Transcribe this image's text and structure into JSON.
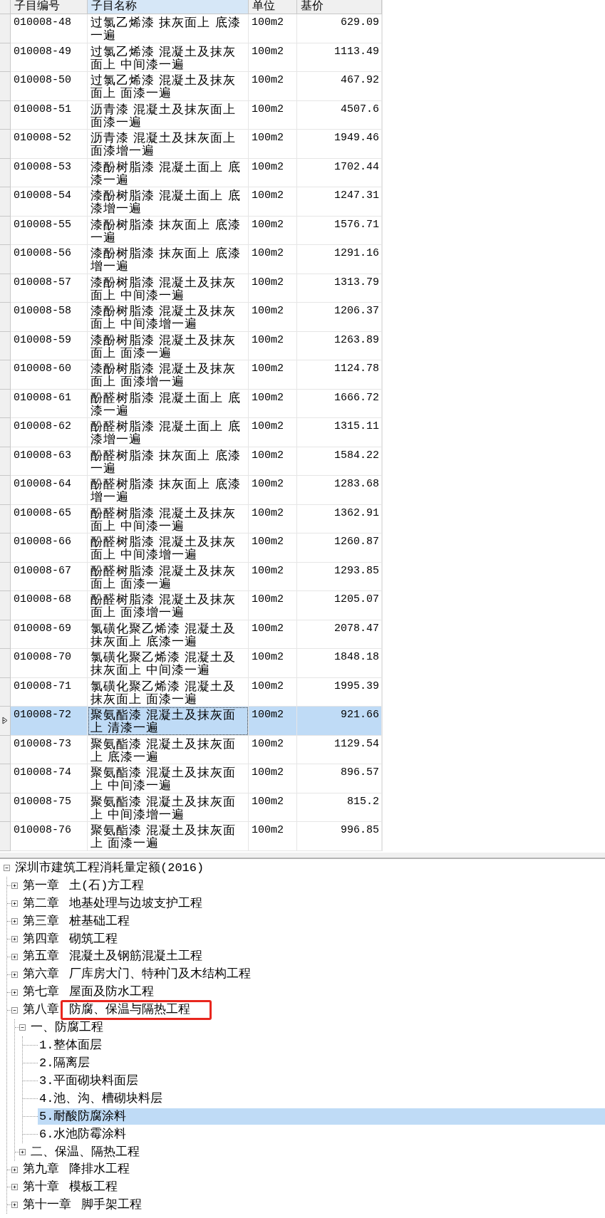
{
  "table": {
    "columns": [
      {
        "label": "子目编号",
        "selected": false
      },
      {
        "label": "子目名称",
        "selected": true
      },
      {
        "label": "单位",
        "selected": false
      },
      {
        "label": "基价",
        "selected": false
      }
    ],
    "rows": [
      {
        "code": "010008-48",
        "name": "过氯乙烯漆 抹灰面上 底漆一遍",
        "unit": "100m2",
        "price": "629.09",
        "selected": false
      },
      {
        "code": "010008-49",
        "name": "过氯乙烯漆 混凝土及抹灰面上 中间漆一遍",
        "unit": "100m2",
        "price": "1113.49",
        "selected": false
      },
      {
        "code": "010008-50",
        "name": "过氯乙烯漆 混凝土及抹灰面上 面漆一遍",
        "unit": "100m2",
        "price": "467.92",
        "selected": false
      },
      {
        "code": "010008-51",
        "name": "沥青漆 混凝土及抹灰面上面漆一遍",
        "unit": "100m2",
        "price": "4507.6",
        "selected": false
      },
      {
        "code": "010008-52",
        "name": "沥青漆 混凝土及抹灰面上面漆增一遍",
        "unit": "100m2",
        "price": "1949.46",
        "selected": false
      },
      {
        "code": "010008-53",
        "name": "漆酚树脂漆 混凝土面上 底漆一遍",
        "unit": "100m2",
        "price": "1702.44",
        "selected": false
      },
      {
        "code": "010008-54",
        "name": "漆酚树脂漆 混凝土面上 底漆增一遍",
        "unit": "100m2",
        "price": "1247.31",
        "selected": false
      },
      {
        "code": "010008-55",
        "name": "漆酚树脂漆 抹灰面上 底漆一遍",
        "unit": "100m2",
        "price": "1576.71",
        "selected": false
      },
      {
        "code": "010008-56",
        "name": "漆酚树脂漆 抹灰面上 底漆增一遍",
        "unit": "100m2",
        "price": "1291.16",
        "selected": false
      },
      {
        "code": "010008-57",
        "name": "漆酚树脂漆 混凝土及抹灰面上 中间漆一遍",
        "unit": "100m2",
        "price": "1313.79",
        "selected": false
      },
      {
        "code": "010008-58",
        "name": "漆酚树脂漆 混凝土及抹灰面上 中间漆增一遍",
        "unit": "100m2",
        "price": "1206.37",
        "selected": false
      },
      {
        "code": "010008-59",
        "name": "漆酚树脂漆 混凝土及抹灰面上 面漆一遍",
        "unit": "100m2",
        "price": "1263.89",
        "selected": false
      },
      {
        "code": "010008-60",
        "name": "漆酚树脂漆 混凝土及抹灰面上 面漆增一遍",
        "unit": "100m2",
        "price": "1124.78",
        "selected": false
      },
      {
        "code": "010008-61",
        "name": "酚醛树脂漆 混凝土面上 底漆一遍",
        "unit": "100m2",
        "price": "1666.72",
        "selected": false
      },
      {
        "code": "010008-62",
        "name": "酚醛树脂漆 混凝土面上 底漆增一遍",
        "unit": "100m2",
        "price": "1315.11",
        "selected": false
      },
      {
        "code": "010008-63",
        "name": "酚醛树脂漆 抹灰面上 底漆一遍",
        "unit": "100m2",
        "price": "1584.22",
        "selected": false
      },
      {
        "code": "010008-64",
        "name": "酚醛树脂漆 抹灰面上 底漆增一遍",
        "unit": "100m2",
        "price": "1283.68",
        "selected": false
      },
      {
        "code": "010008-65",
        "name": "酚醛树脂漆 混凝土及抹灰面上 中间漆一遍",
        "unit": "100m2",
        "price": "1362.91",
        "selected": false
      },
      {
        "code": "010008-66",
        "name": "酚醛树脂漆 混凝土及抹灰面上 中间漆增一遍",
        "unit": "100m2",
        "price": "1260.87",
        "selected": false
      },
      {
        "code": "010008-67",
        "name": "酚醛树脂漆 混凝土及抹灰面上 面漆一遍",
        "unit": "100m2",
        "price": "1293.85",
        "selected": false
      },
      {
        "code": "010008-68",
        "name": "酚醛树脂漆 混凝土及抹灰面上 面漆增一遍",
        "unit": "100m2",
        "price": "1205.07",
        "selected": false
      },
      {
        "code": "010008-69",
        "name": "氯磺化聚乙烯漆 混凝土及抹灰面上 底漆一遍",
        "unit": "100m2",
        "price": "2078.47",
        "selected": false
      },
      {
        "code": "010008-70",
        "name": "氯磺化聚乙烯漆 混凝土及抹灰面上 中间漆一遍",
        "unit": "100m2",
        "price": "1848.18",
        "selected": false
      },
      {
        "code": "010008-71",
        "name": "氯磺化聚乙烯漆 混凝土及抹灰面上 面漆一遍",
        "unit": "100m2",
        "price": "1995.39",
        "selected": false
      },
      {
        "code": "010008-72",
        "name": "聚氨酯漆 混凝土及抹灰面上 清漆一遍",
        "unit": "100m2",
        "price": "921.66",
        "selected": true
      },
      {
        "code": "010008-73",
        "name": "聚氨酯漆 混凝土及抹灰面上 底漆一遍",
        "unit": "100m2",
        "price": "1129.54",
        "selected": false
      },
      {
        "code": "010008-74",
        "name": "聚氨酯漆 混凝土及抹灰面上 中间漆一遍",
        "unit": "100m2",
        "price": "896.57",
        "selected": false
      },
      {
        "code": "010008-75",
        "name": "聚氨酯漆 混凝土及抹灰面上 中间漆增一遍",
        "unit": "100m2",
        "price": "815.2",
        "selected": false
      },
      {
        "code": "010008-76",
        "name": "聚氨酯漆 混凝土及抹灰面上 面漆一遍",
        "unit": "100m2",
        "price": "996.85",
        "selected": false
      }
    ]
  },
  "tree": {
    "label": "深圳市建筑工程消耗量定额(2016)",
    "expanded": true,
    "children": [
      {
        "number": "第一章",
        "title": "土(石)方工程",
        "expanded": false
      },
      {
        "number": "第二章",
        "title": "地基处理与边坡支护工程",
        "expanded": false
      },
      {
        "number": "第三章",
        "title": "桩基础工程",
        "expanded": false
      },
      {
        "number": "第四章",
        "title": "砌筑工程",
        "expanded": false
      },
      {
        "number": "第五章",
        "title": "混凝土及钢筋混凝土工程",
        "expanded": false
      },
      {
        "number": "第六章",
        "title": "厂库房大门、特种门及木结构工程",
        "expanded": false
      },
      {
        "number": "第七章",
        "title": "屋面及防水工程",
        "expanded": false
      },
      {
        "number": "第八章",
        "title": "防腐、保温与隔热工程",
        "expanded": true,
        "highlighted": true,
        "children": [
          {
            "label": "一、防腐工程",
            "expanded": true,
            "children": [
              {
                "label": "1.整体面层",
                "selected": false
              },
              {
                "label": "2.隔离层",
                "selected": false
              },
              {
                "label": "3.平面砌块料面层",
                "selected": false
              },
              {
                "label": "4.池、沟、槽砌块料层",
                "selected": false
              },
              {
                "label": "5.耐酸防腐涂料",
                "selected": true
              },
              {
                "label": "6.水池防霉涂料",
                "selected": false
              }
            ]
          },
          {
            "label": "二、保温、隔热工程",
            "expanded": false
          }
        ]
      },
      {
        "number": "第九章",
        "title": "降排水工程",
        "expanded": false
      },
      {
        "number": "第十章",
        "title": "模板工程",
        "expanded": false
      },
      {
        "number": "第十一章",
        "title": "脚手架工程",
        "expanded": false
      }
    ]
  }
}
